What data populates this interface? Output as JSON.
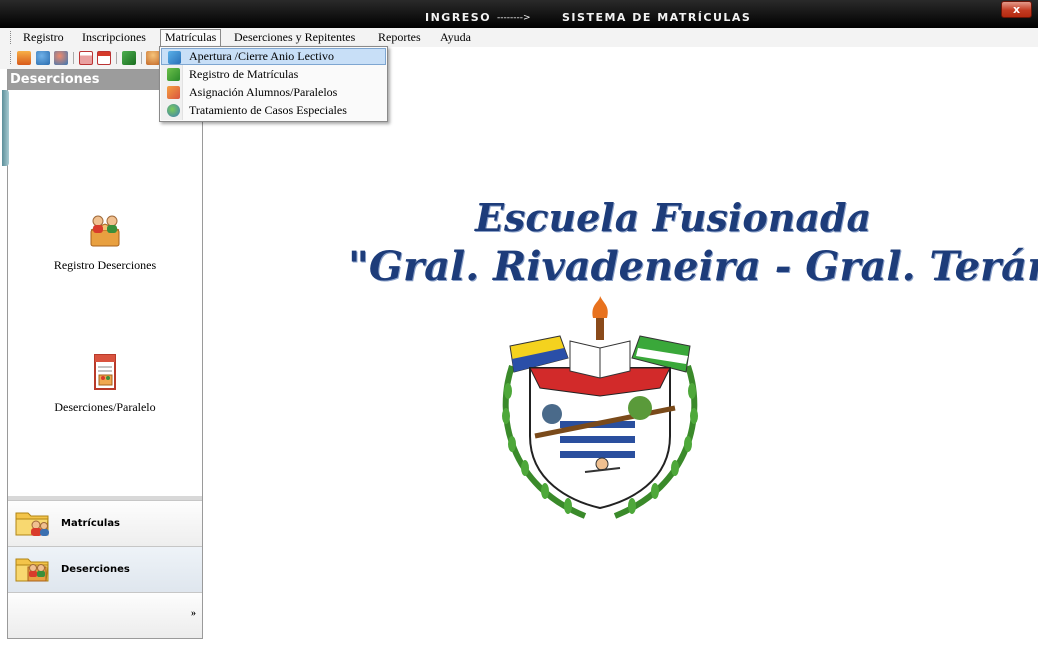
{
  "window": {
    "title_left": "INGRESO",
    "title_arrow": "-------->",
    "title_right": "SISTEMA DE MATRÍCULAS",
    "close_label": "x"
  },
  "menubar": {
    "items": [
      "Registro",
      "Inscripciones",
      "Matrículas",
      "Deserciones y Repitentes",
      "Reportes",
      "Ayuda"
    ],
    "open_item": "Matrículas"
  },
  "dropdown": {
    "items": [
      {
        "label": "Apertura /Cierre Anio Lectivo",
        "icon": "folder-calendar-icon",
        "highlighted": true
      },
      {
        "label": "Registro de Matrículas",
        "icon": "green-book-icon",
        "highlighted": false
      },
      {
        "label": "Asignación Alumnos/Paralelos",
        "icon": "students-assign-icon",
        "highlighted": false
      },
      {
        "label": "Tratamiento de Casos Especiales",
        "icon": "special-cases-icon",
        "highlighted": false
      }
    ]
  },
  "toolbar": {
    "icons": [
      "home-icon",
      "users-icon",
      "group-icon",
      "calendar-icon",
      "calendar-red-icon",
      "book-icon",
      "people-icon"
    ]
  },
  "sidebar": {
    "header": "Deserciones",
    "entries": [
      {
        "label": "Registro Deserciones",
        "icon": "people-box-icon"
      },
      {
        "label": "Deserciones/Paralelo",
        "icon": "report-document-icon"
      }
    ],
    "splitter_dots": "........",
    "groups": [
      {
        "label": "Matrículas",
        "icon": "folder-people-icon",
        "active": false
      },
      {
        "label": "Deserciones",
        "icon": "folder-people-icon",
        "active": true
      }
    ],
    "overflow_chevron": "»"
  },
  "main": {
    "school_line1": "Escuela Fusionada",
    "school_line2": "\"Gral. Rivadeneira - Gral. Terán\""
  },
  "colors": {
    "title_bar": "#000000",
    "school_text": "#1d3c7a",
    "sidebar_header": "#9c9c9c",
    "menu_highlight": "#c8dff7"
  }
}
